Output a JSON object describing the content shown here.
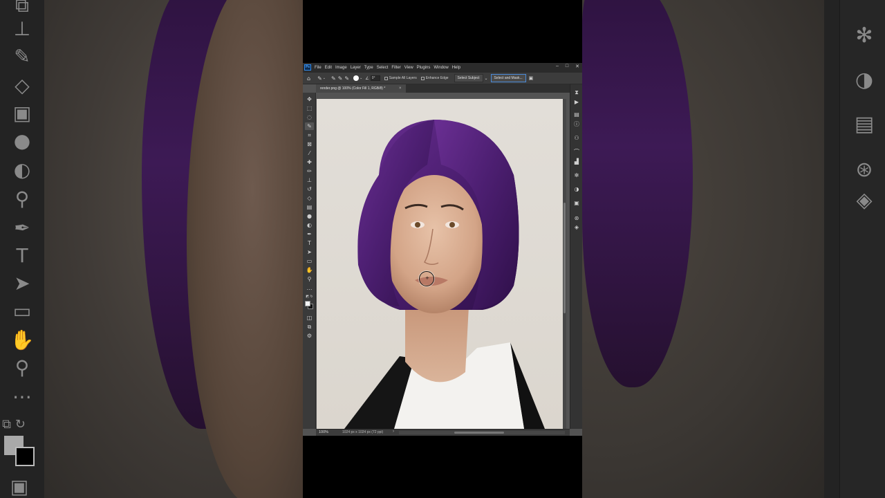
{
  "app": {
    "logo": "Ps"
  },
  "menu": [
    "File",
    "Edit",
    "Image",
    "Layer",
    "Type",
    "Select",
    "Filter",
    "View",
    "Plugins",
    "Window",
    "Help"
  ],
  "window_controls": {
    "minimize": "–",
    "maximize": "□",
    "close": "✕"
  },
  "options_bar": {
    "brush_size": "30",
    "angle_value": "0°",
    "sample_all_layers": "Sample All Layers",
    "enhance_edge": "Enhance Edge",
    "select_subject": "Select Subject",
    "select_and_mask": "Select and Mask..."
  },
  "document": {
    "tab_title": "render.png @ 100% (Color Fill 1, RGB/8) *",
    "tab_close": "×"
  },
  "status_bar": {
    "zoom": "100%",
    "doc_info": "1024 px x 1024 px (72 ppi)",
    "arrow": "›"
  },
  "colors": {
    "hair_purple": "#4a1f6b",
    "canvas_bg": "#ded9d1",
    "accent_blue": "#2d8bf0",
    "foreground_color": "#f4f4f4",
    "background_color": "#111111"
  },
  "icons": {
    "left_tools": [
      "move",
      "marquee",
      "lasso",
      "quick-selection",
      "crop",
      "frame",
      "eyedropper",
      "healing",
      "brush",
      "clone-stamp",
      "history-brush",
      "eraser",
      "gradient",
      "blur",
      "dodge",
      "pen",
      "type",
      "path-selection",
      "rectangle",
      "hand",
      "zoom",
      "more"
    ],
    "right_panel": [
      "history",
      "play",
      "libraries",
      "info",
      "character",
      "paths",
      "histogram",
      "adjustments",
      "properties",
      "channels",
      "layers"
    ]
  }
}
